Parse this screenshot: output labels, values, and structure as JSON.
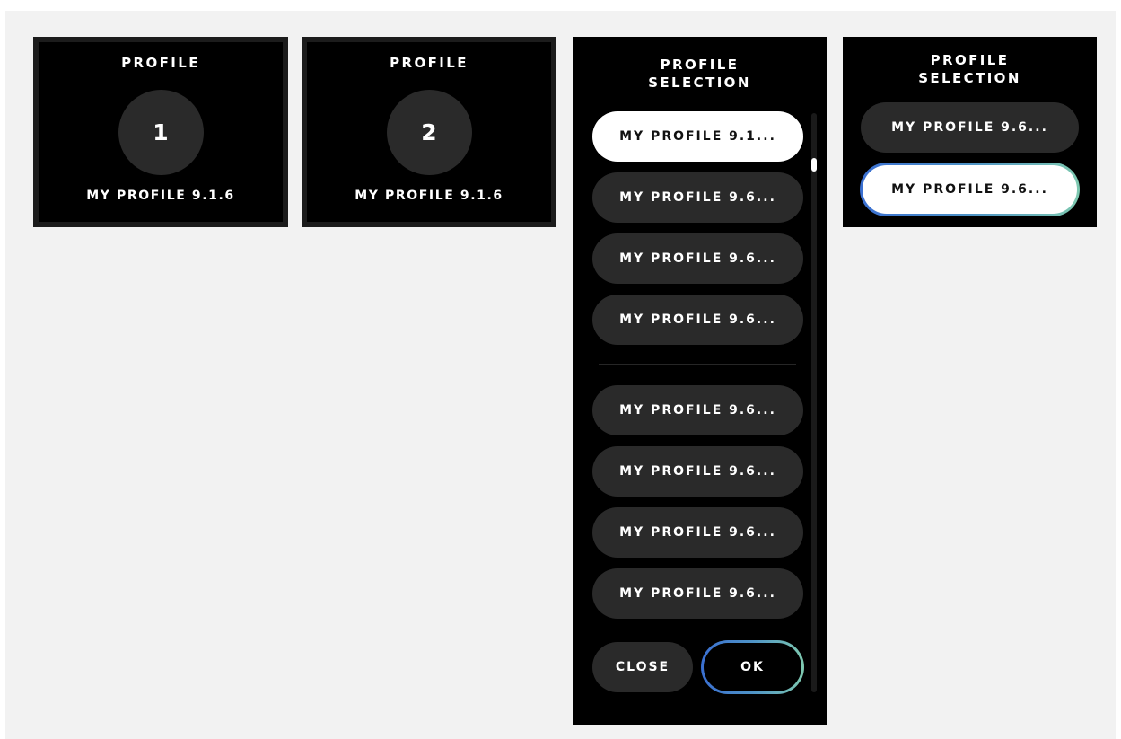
{
  "tiles": [
    {
      "title": "PROFILE",
      "number": "1",
      "name": "MY PROFILE 9.1.6"
    },
    {
      "title": "PROFILE",
      "number": "2",
      "name": "MY PROFILE 9.1.6"
    }
  ],
  "selection_list": {
    "title_line1": "PROFILE",
    "title_line2": "SELECTION",
    "items": [
      {
        "label": "MY PROFILE 9.1...",
        "selected": true
      },
      {
        "label": "MY PROFILE 9.6...",
        "selected": false
      },
      {
        "label": "MY PROFILE 9.6...",
        "selected": false
      },
      {
        "label": "MY PROFILE 9.6...",
        "selected": false
      },
      {
        "label": "MY PROFILE 9.6...",
        "selected": false
      },
      {
        "label": "MY PROFILE 9.6...",
        "selected": false
      },
      {
        "label": "MY PROFILE 9.6...",
        "selected": false
      },
      {
        "label": "MY PROFILE 9.6...",
        "selected": false
      }
    ],
    "close_label": "CLOSE",
    "ok_label": "OK",
    "scroll_position": 0.08
  },
  "mini_selection": {
    "title_line1": "PROFILE",
    "title_line2": "SELECTION",
    "items": [
      {
        "label": "MY PROFILE 9.6...",
        "selected": false
      },
      {
        "label": "MY PROFILE 9.6...",
        "selected": true
      }
    ]
  },
  "colors": {
    "panel_bg": "#000000",
    "pill_bg": "#2a2a2a",
    "selected_bg": "#ffffff",
    "accent_gradient_start": "#3a6fd1",
    "accent_gradient_end": "#7ec9b0",
    "canvas_bg": "#f2f2f2"
  }
}
